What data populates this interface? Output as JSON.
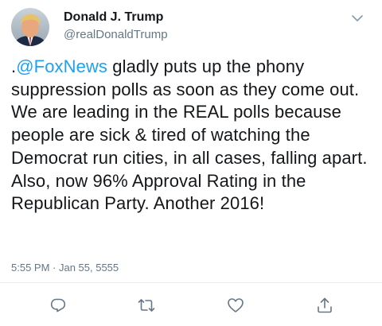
{
  "tweet": {
    "author_name": "Donald J. Trump",
    "author_handle": "@realDonaldTrump",
    "text_prefix": ".",
    "mention": "@FoxNews",
    "text_body": " gladly puts up the phony suppression polls as soon as they come out. We are leading in the REAL polls because people are sick & tired of watching the Democrat run cities, in all cases, falling apart. Also, now 96% Approval Rating in the Republican Party. Another 2016!",
    "timestamp": "5:55 PM · Jan 55, 5555"
  },
  "icons": {
    "more": "chevron-down-icon",
    "reply": "reply-icon",
    "retweet": "retweet-icon",
    "like": "heart-icon",
    "share": "share-icon"
  },
  "colors": {
    "link": "#1da1f2",
    "secondary_text": "#657786",
    "primary_text": "#14171a",
    "icon": "#657786"
  }
}
